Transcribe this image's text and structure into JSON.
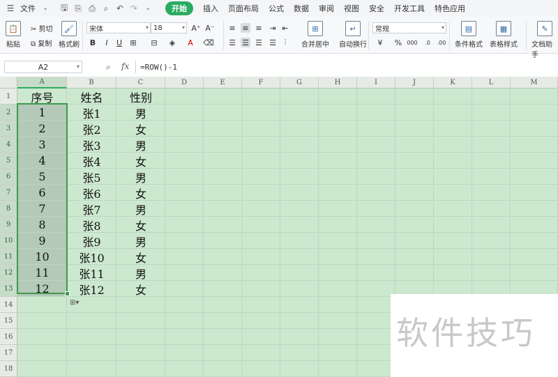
{
  "menu": {
    "file_label": "文件",
    "tabs": [
      "开始",
      "插入",
      "页面布局",
      "公式",
      "数据",
      "审阅",
      "视图",
      "安全",
      "开发工具",
      "特色应用"
    ],
    "active_tab": "开始"
  },
  "ribbon": {
    "paste": "粘贴",
    "cut": "剪切",
    "copy": "复制",
    "format_painter": "格式刷",
    "font_name": "宋体",
    "font_size": "18",
    "merge_center": "合并居中",
    "wrap_text": "自动换行",
    "number_format": "常规",
    "conditional_format": "条件格式",
    "table_style": "表格样式",
    "doc_helper": "文档助手"
  },
  "formula_bar": {
    "name_box": "A2",
    "fx": "fx",
    "formula": "=ROW()-1"
  },
  "grid": {
    "columns": [
      "A",
      "B",
      "C",
      "D",
      "E",
      "F",
      "G",
      "H",
      "I",
      "J",
      "K",
      "L",
      "M"
    ],
    "rows": [
      "1",
      "2",
      "3",
      "4",
      "5",
      "6",
      "7",
      "8",
      "9",
      "10",
      "11",
      "12",
      "13",
      "14",
      "15",
      "16",
      "17",
      "18"
    ],
    "header": [
      "序号",
      "姓名",
      "性别"
    ],
    "data": [
      [
        "1",
        "张1",
        "男"
      ],
      [
        "2",
        "张2",
        "女"
      ],
      [
        "3",
        "张3",
        "男"
      ],
      [
        "4",
        "张4",
        "女"
      ],
      [
        "5",
        "张5",
        "男"
      ],
      [
        "6",
        "张6",
        "女"
      ],
      [
        "7",
        "张7",
        "男"
      ],
      [
        "8",
        "张8",
        "女"
      ],
      [
        "9",
        "张9",
        "男"
      ],
      [
        "10",
        "张10",
        "女"
      ],
      [
        "11",
        "张11",
        "男"
      ],
      [
        "12",
        "张12",
        "女"
      ]
    ]
  },
  "watermark": "软件技巧",
  "colors": {
    "accent": "#2aab61",
    "sheet_bg": "#cce8cf",
    "selection_border": "#3c9a50"
  }
}
